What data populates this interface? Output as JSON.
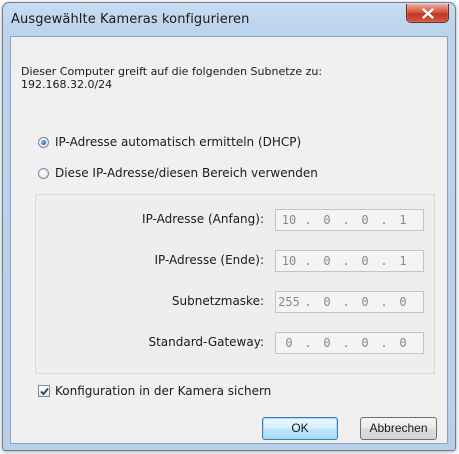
{
  "window": {
    "title": "Ausgewählte Kameras konfigurieren"
  },
  "info": {
    "line1": "Dieser Computer greift auf die folgenden Subnetze zu:",
    "line2": "192.168.32.0/24"
  },
  "mode": {
    "dhcp_label": "IP-Adresse automatisch ermitteln (DHCP)",
    "static_label": "Diese IP-Adresse/diesen Bereich verwenden",
    "selected": "dhcp"
  },
  "fields": [
    {
      "label": "IP-Adresse (Anfang):",
      "octets": [
        "10",
        "0",
        "0",
        "1"
      ]
    },
    {
      "label": "IP-Adresse (Ende):",
      "octets": [
        "10",
        "0",
        "0",
        "1"
      ]
    },
    {
      "label": "Subnetzmaske:",
      "octets": [
        "255",
        "0",
        "0",
        "0"
      ]
    },
    {
      "label": "Standard-Gateway:",
      "octets": [
        "0",
        "0",
        "0",
        "0"
      ]
    }
  ],
  "options": {
    "save_label": "Konfiguration in der Kamera sichern",
    "save_checked": true
  },
  "buttons": {
    "ok": "OK",
    "cancel": "Abbrechen"
  },
  "colors": {
    "title_bar": "#bcd3ec",
    "close_button": "#c2361d",
    "default_button_border": "#3c7fb1",
    "disabled_text": "#8a8a8a"
  }
}
